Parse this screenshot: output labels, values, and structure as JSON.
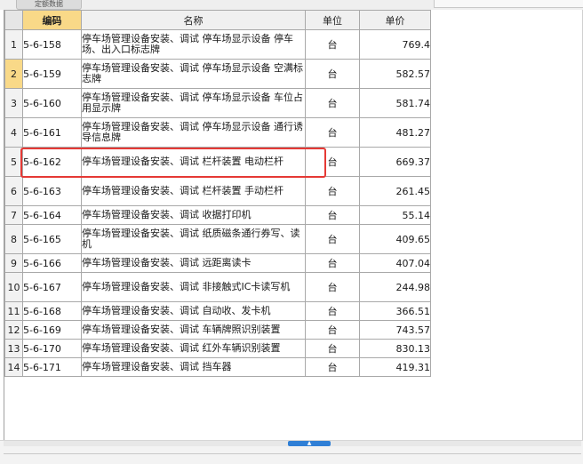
{
  "top_tab": {
    "label": "定额数据"
  },
  "table": {
    "headers": {
      "code": "编码",
      "name": "名称",
      "unit": "单位",
      "price": "单价"
    },
    "selected_row": 1,
    "rows": [
      {
        "idx": "1",
        "code": "5-6-158",
        "name": "停车场管理设备安装、调试 停车场显示设备 停车场、出入口标志牌",
        "unit": "台",
        "price": "769.4"
      },
      {
        "idx": "2",
        "code": "5-6-159",
        "name": "停车场管理设备安装、调试 停车场显示设备 空满标志牌",
        "unit": "台",
        "price": "582.57"
      },
      {
        "idx": "3",
        "code": "5-6-160",
        "name": "停车场管理设备安装、调试 停车场显示设备 车位占用显示牌",
        "unit": "台",
        "price": "581.74"
      },
      {
        "idx": "4",
        "code": "5-6-161",
        "name": "停车场管理设备安装、调试 停车场显示设备 通行诱导信息牌",
        "unit": "台",
        "price": "481.27"
      },
      {
        "idx": "5",
        "code": "5-6-162",
        "name": "停车场管理设备安装、调试 栏杆装置 电动栏杆",
        "unit": "台",
        "price": "669.37"
      },
      {
        "idx": "6",
        "code": "5-6-163",
        "name": "停车场管理设备安装、调试 栏杆装置 手动栏杆",
        "unit": "台",
        "price": "261.45"
      },
      {
        "idx": "7",
        "code": "5-6-164",
        "name": "停车场管理设备安装、调试 收据打印机",
        "unit": "台",
        "price": "55.14"
      },
      {
        "idx": "8",
        "code": "5-6-165",
        "name": "停车场管理设备安装、调试 纸质磁条通行券写、读机",
        "unit": "台",
        "price": "409.65"
      },
      {
        "idx": "9",
        "code": "5-6-166",
        "name": "停车场管理设备安装、调试 远距离读卡",
        "unit": "台",
        "price": "407.04"
      },
      {
        "idx": "10",
        "code": "5-6-167",
        "name": "停车场管理设备安装、调试 非接触式IC卡读写机",
        "unit": "台",
        "price": "244.98"
      },
      {
        "idx": "11",
        "code": "5-6-168",
        "name": "停车场管理设备安装、调试 自动收、发卡机",
        "unit": "台",
        "price": "366.51"
      },
      {
        "idx": "12",
        "code": "5-6-169",
        "name": "停车场管理设备安装、调试 车辆牌照识别装置",
        "unit": "台",
        "price": "743.57"
      },
      {
        "idx": "13",
        "code": "5-6-170",
        "name": "停车场管理设备安装、调试 红外车辆识别装置",
        "unit": "台",
        "price": "830.13"
      },
      {
        "idx": "14",
        "code": "5-6-171",
        "name": "停车场管理设备安装、调试 挡车器",
        "unit": "台",
        "price": "419.31"
      }
    ]
  },
  "scrollbar": {
    "thumb_glyph": "▲"
  }
}
